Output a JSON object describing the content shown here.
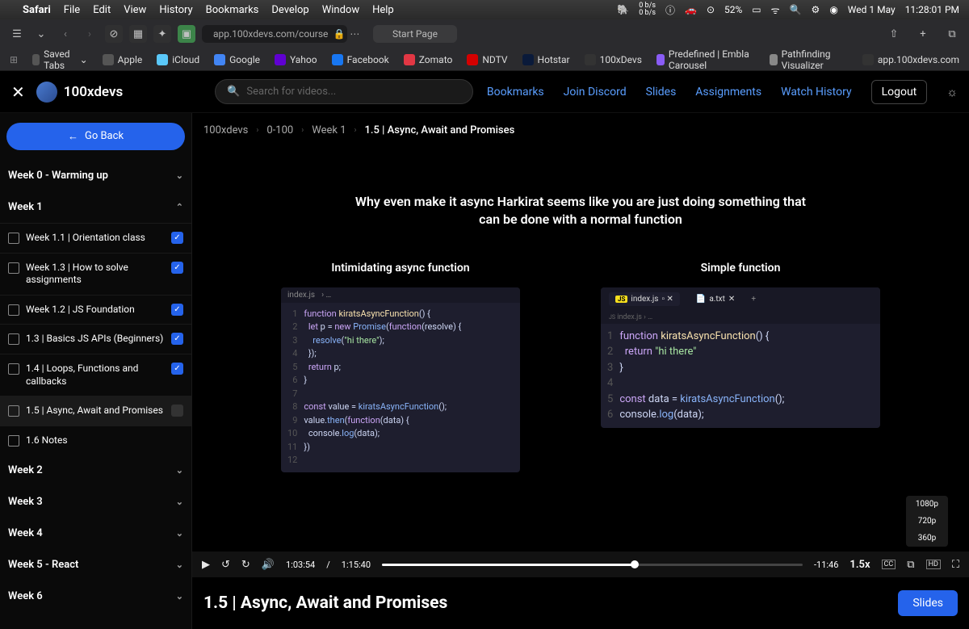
{
  "menubar": {
    "app": "Safari",
    "items": [
      "File",
      "Edit",
      "View",
      "History",
      "Bookmarks",
      "Develop",
      "Window",
      "Help"
    ],
    "netspeed": [
      "0 b/s",
      "0 b/s"
    ],
    "battery": "52%",
    "date": "Wed 1 May",
    "time": "11:28:01 PM"
  },
  "browser": {
    "url": "app.100xdevs.com/course",
    "start_page": "Start Page"
  },
  "favorites": [
    {
      "label": "Saved Tabs",
      "color": "#888"
    },
    {
      "label": "Apple",
      "color": "#555"
    },
    {
      "label": "iCloud",
      "color": "#5ac8fa"
    },
    {
      "label": "Google",
      "color": "#4285f4"
    },
    {
      "label": "Yahoo",
      "color": "#6001d2"
    },
    {
      "label": "Facebook",
      "color": "#1877f2"
    },
    {
      "label": "Zomato",
      "color": "#e23744"
    },
    {
      "label": "NDTV",
      "color": "#d40000"
    },
    {
      "label": "Hotstar",
      "color": "#0a1a3a"
    },
    {
      "label": "100xDevs",
      "color": "#333"
    },
    {
      "label": "Predefined | Embla Carousel",
      "color": "#8a5cf6"
    },
    {
      "label": "Pathfinding Visualizer",
      "color": "#888"
    },
    {
      "label": "app.100xdevs.com",
      "color": "#333"
    }
  ],
  "header": {
    "brand": "100xdevs",
    "search_placeholder": "Search for videos...",
    "links": [
      "Bookmarks",
      "Join Discord",
      "Slides",
      "Assignments",
      "Watch History"
    ],
    "logout": "Logout"
  },
  "sidebar": {
    "go_back": "Go Back",
    "weeks": [
      {
        "title": "Week 0 - Warming up",
        "open": false
      },
      {
        "title": "Week 1",
        "open": true,
        "lessons": [
          {
            "t": "Week 1.1 | Orientation class",
            "done": true
          },
          {
            "t": "Week 1.3 | How to solve assignments",
            "done": true
          },
          {
            "t": "Week 1.2 | JS Foundation",
            "done": true
          },
          {
            "t": "1.3 | Basics JS APIs (Beginners)",
            "done": true
          },
          {
            "t": "1.4 | Loops, Functions and callbacks",
            "done": true
          },
          {
            "t": "1.5 | Async, Await and Promises",
            "done": false,
            "active": true
          },
          {
            "t": "1.6 Notes",
            "done": false,
            "doc": true
          }
        ]
      },
      {
        "title": "Week 2",
        "open": false
      },
      {
        "title": "Week 3",
        "open": false
      },
      {
        "title": "Week 4",
        "open": false
      },
      {
        "title": "Week 5 - React",
        "open": false
      },
      {
        "title": "Week 6",
        "open": false
      }
    ]
  },
  "breadcrumb": [
    "100xdevs",
    "0-100",
    "Week 1",
    "1.5 | Async, Await and Promises"
  ],
  "video": {
    "heading": "Why even make it async Harkirat seems like you are just doing something that can be done with a normal function",
    "left_label": "Intimidating async function",
    "right_label": "Simple function",
    "file": "index.js",
    "file2": "a.txt",
    "current": "1:03:54",
    "total": "1:15:40",
    "remaining": "-11:46",
    "speed": "1.5x",
    "quality": [
      "1080p",
      "720p",
      "360p"
    ]
  },
  "title": "1.5 | Async, Await and Promises",
  "slides_btn": "Slides"
}
